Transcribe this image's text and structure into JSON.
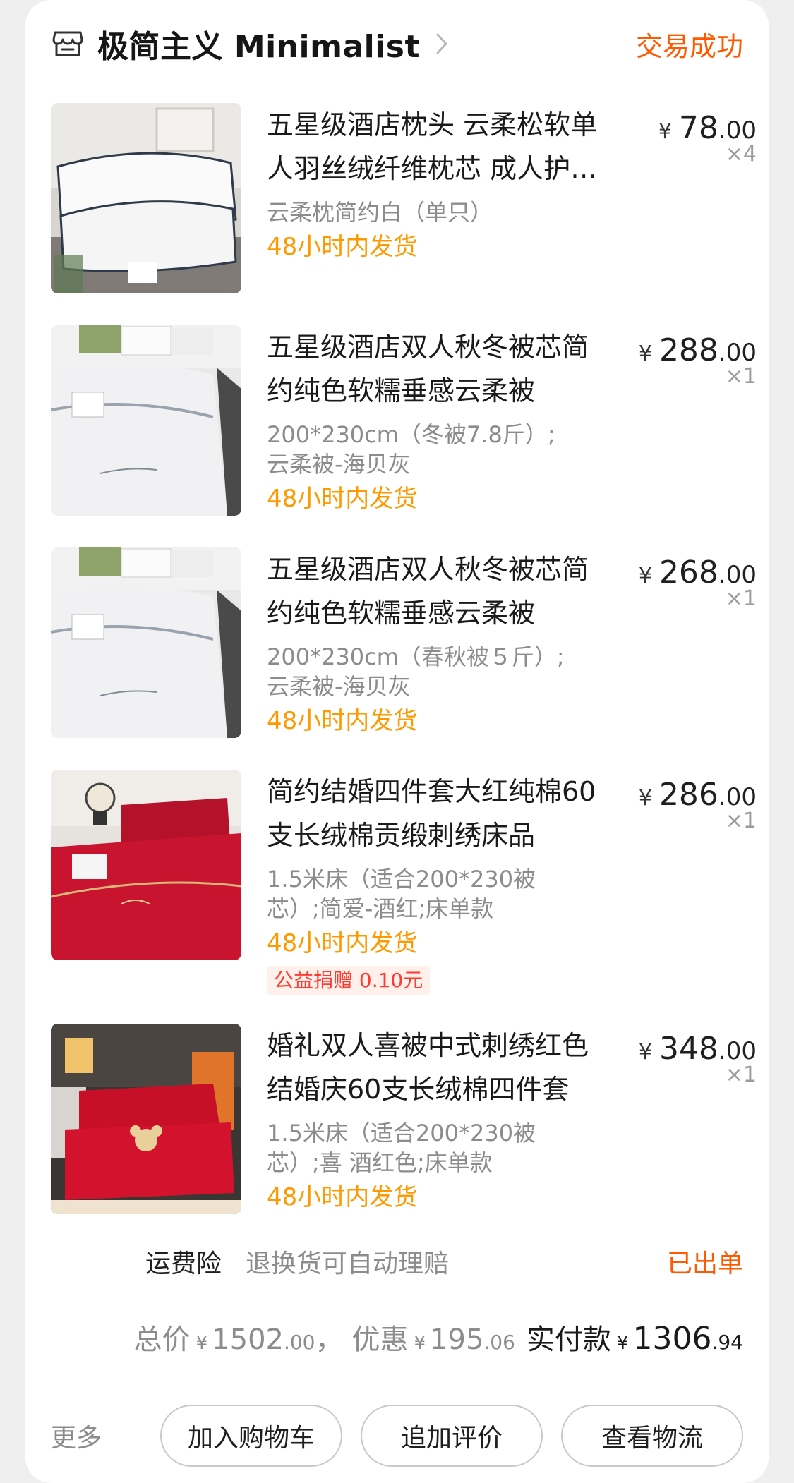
{
  "store": {
    "name": "极简主义 Minimalist",
    "status": "交易成功"
  },
  "items": [
    {
      "title": "五星级酒店枕头 云柔松软单人羽丝绒纤维枕芯 成人护颈枕",
      "spec_lines": [
        "云柔枕简约白（单只）"
      ],
      "shipping": "48小时内发货",
      "price_int": "78",
      "price_dec": ".00",
      "qty": "×4",
      "badge": ""
    },
    {
      "title": "五星级酒店双人秋冬被芯简约纯色软糯垂感云柔被",
      "spec_lines": [
        "200*230cm（冬被7.8斤）;",
        "云柔被-海贝灰"
      ],
      "shipping": "48小时内发货",
      "price_int": "288",
      "price_dec": ".00",
      "qty": "×1",
      "badge": ""
    },
    {
      "title": "五星级酒店双人秋冬被芯简约纯色软糯垂感云柔被",
      "spec_lines": [
        "200*230cm（春秋被５斤）;",
        "云柔被-海贝灰"
      ],
      "shipping": "48小时内发货",
      "price_int": "268",
      "price_dec": ".00",
      "qty": "×1",
      "badge": ""
    },
    {
      "title": "简约结婚四件套大红纯棉60支长绒棉贡缎刺绣床品",
      "spec_lines": [
        "1.5米床（适合200*230被",
        "芯）;简爱-酒红;床单款"
      ],
      "shipping": "48小时内发货",
      "price_int": "286",
      "price_dec": ".00",
      "qty": "×1",
      "badge": "公益捐赠 0.10元"
    },
    {
      "title": "婚礼双人喜被中式刺绣红色结婚庆60支长绒棉四件套",
      "spec_lines": [
        "1.5米床（适合200*230被",
        "芯）;喜 酒红色;床单款"
      ],
      "shipping": "48小时内发货",
      "price_int": "348",
      "price_dec": ".00",
      "qty": "×1",
      "badge": ""
    }
  ],
  "currency_symbol": "¥",
  "insurance": {
    "label": "运费险",
    "desc": "退换货可自动理赔",
    "status": "已出单"
  },
  "totals": {
    "total_label": "总价",
    "total_int": "1502",
    "total_dec": ".00",
    "separator": "，",
    "discount_label": "优惠",
    "discount_int": "195",
    "discount_dec": ".06",
    "paid_label": "实付款",
    "paid_int": "1306",
    "paid_dec": ".94"
  },
  "footer": {
    "more": "更多",
    "buttons": [
      "加入购物车",
      "追加评价",
      "查看物流"
    ]
  },
  "colors": {
    "accent": "#ff5a00",
    "shipping": "#ff9900",
    "muted": "#8c8c8c"
  }
}
